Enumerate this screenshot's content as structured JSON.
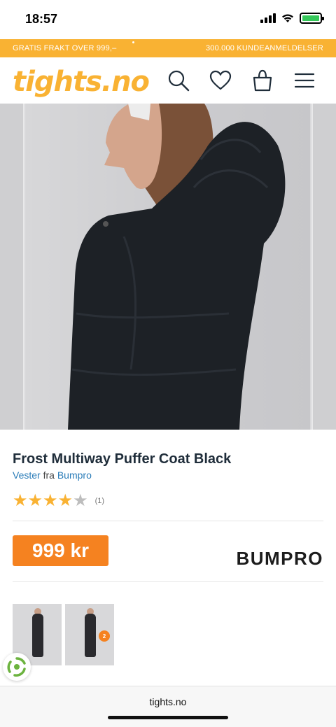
{
  "status_bar": {
    "time": "18:57"
  },
  "promo": {
    "left_text": "GRATIS FRAKT OVER 999,–",
    "right_text": "300.000 KUNDEANMELDELSER"
  },
  "header": {
    "logo_text": "tights.no",
    "icons": [
      "search-icon",
      "heart-icon",
      "bag-icon",
      "menu-icon"
    ],
    "brand_color": "#f9b233"
  },
  "product": {
    "title": "Frost Multiway Puffer Coat Black",
    "category": "Vester",
    "from_word": "fra",
    "brand": "Bumpro",
    "rating": 4,
    "rating_max": 5,
    "review_count": "(1)",
    "price": "999 kr",
    "price_color": "#f58220",
    "brand_logo": "BUMPRO"
  },
  "thumbnails": [
    {
      "badge": ""
    },
    {
      "badge": "2"
    }
  ],
  "browser": {
    "url": "tights.no"
  }
}
